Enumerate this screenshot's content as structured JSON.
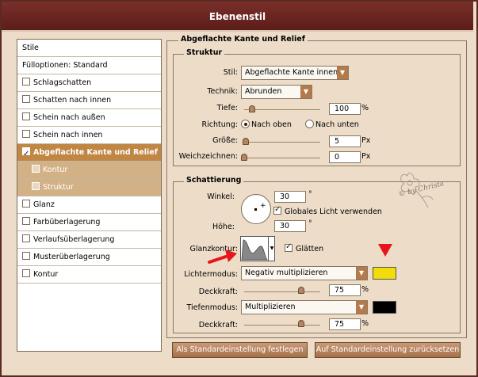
{
  "window": {
    "title": "Ebenenstil"
  },
  "sidebar": {
    "items": [
      {
        "label": "Stile",
        "checkbox": false
      },
      {
        "label": "Fülloptionen: Standard",
        "checkbox": false
      },
      {
        "label": "Schlagschatten",
        "checkbox": true,
        "checked": false
      },
      {
        "label": "Schatten nach innen",
        "checkbox": true,
        "checked": false
      },
      {
        "label": "Schein nach außen",
        "checkbox": true,
        "checked": false
      },
      {
        "label": "Schein nach innen",
        "checkbox": true,
        "checked": false
      },
      {
        "label": "Abgeflachte Kante und Relief",
        "checkbox": true,
        "checked": true,
        "selected": true
      },
      {
        "label": "Kontur",
        "checkbox": true,
        "checked": false,
        "sub": true
      },
      {
        "label": "Struktur",
        "checkbox": true,
        "checked": false,
        "sub": true
      },
      {
        "label": "Glanz",
        "checkbox": true,
        "checked": false
      },
      {
        "label": "Farbüberlagerung",
        "checkbox": true,
        "checked": false
      },
      {
        "label": "Verlaufsüberlagerung",
        "checkbox": true,
        "checked": false
      },
      {
        "label": "Musterüberlagerung",
        "checkbox": true,
        "checked": false
      },
      {
        "label": "Kontur",
        "checkbox": true,
        "checked": false
      }
    ]
  },
  "bevel": {
    "title": "Abgeflachte Kante und Relief",
    "structure": {
      "title": "Struktur",
      "style_label": "Stil:",
      "style_value": "Abgeflachte Kante innen",
      "technique_label": "Technik:",
      "technique_value": "Abrunden",
      "depth_label": "Tiefe:",
      "depth_value": "100",
      "depth_unit": "%",
      "depth_fraction": 0.1,
      "direction_label": "Richtung:",
      "direction_up": "Nach oben",
      "direction_down": "Nach unten",
      "direction_selected": "Nach oben",
      "size_label": "Größe:",
      "size_value": "5",
      "size_unit": "Px",
      "size_fraction": 0.02,
      "soften_label": "Weichzeichnen:",
      "soften_value": "0",
      "soften_unit": "Px",
      "soften_fraction": 0.0
    },
    "shading": {
      "title": "Schattierung",
      "angle_label": "Winkel:",
      "angle_value": "30",
      "angle_unit": "°",
      "global_light_label": "Globales Licht verwenden",
      "global_light_checked": true,
      "altitude_label": "Höhe:",
      "altitude_value": "30",
      "altitude_unit": "°",
      "gloss_contour_label": "Glanzkontur:",
      "antialias_label": "Glätten",
      "antialias_checked": true,
      "highlight_mode_label": "Lichtermodus:",
      "highlight_mode_value": "Negativ multiplizieren",
      "highlight_color": "#f2dc0a",
      "highlight_opacity_label": "Deckkraft:",
      "highlight_opacity_value": "75",
      "highlight_opacity_unit": "%",
      "highlight_opacity_fraction": 0.75,
      "shadow_mode_label": "Tiefenmodus:",
      "shadow_mode_value": "Multiplizieren",
      "shadow_color": "#000000",
      "shadow_opacity_label": "Deckkraft:",
      "shadow_opacity_value": "75",
      "shadow_opacity_unit": "%",
      "shadow_opacity_fraction": 0.75
    }
  },
  "buttons": {
    "make_default": "Als Standardeinstellung festlegen",
    "reset_default": "Auf Standardeinstellung zurücksetzen"
  },
  "watermark": {
    "text": "© by Christa"
  },
  "colors": {
    "title_bar": "#6b2420",
    "selected_item": "#c08643",
    "sub_item": "#d3b187",
    "panel_bg": "#ecdcc8",
    "annotation_red": "#e8141c"
  }
}
